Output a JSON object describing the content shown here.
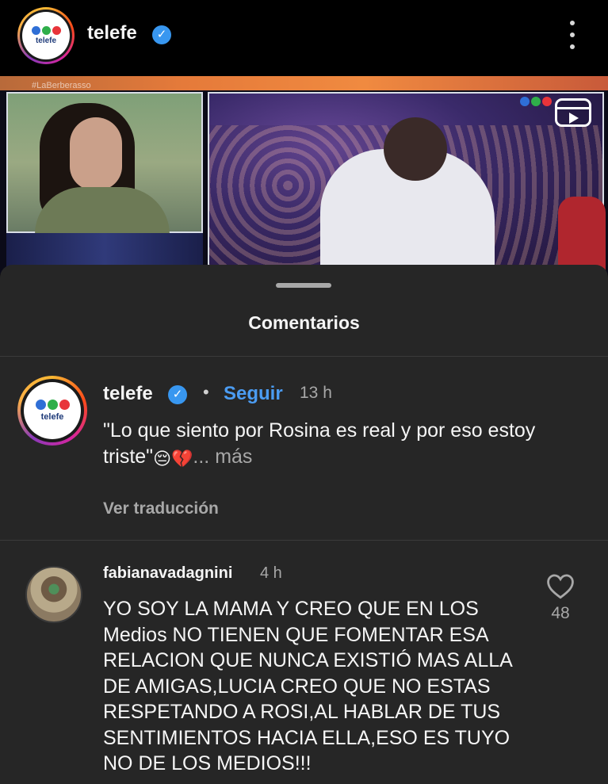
{
  "header": {
    "username": "telefe",
    "avatar_logo_text": "telefe",
    "logo_dot_colors": [
      "#2f6fd6",
      "#2fae4a",
      "#e8343a"
    ],
    "verified_color": "#3897f0",
    "more_icon": "more-vertical-icon"
  },
  "video": {
    "hashtag": "#LaBerberasso",
    "reels_icon": "reels-icon"
  },
  "sheet": {
    "title": "Comentarios"
  },
  "caption": {
    "username": "telefe",
    "avatar_logo_text": "telefe",
    "follow_label": "Seguir",
    "bullet": "•",
    "time": "13 h",
    "text": "\"Lo que siento por Rosina es real y por eso estoy triste\"",
    "emoji_1": "😔",
    "emoji_2": "💔",
    "more_label": "... más",
    "translate_label": "Ver traducción"
  },
  "comments": [
    {
      "username": "fabianavadagnini",
      "time": "4 h",
      "text": "YO SOY LA MAMA Y CREO QUE EN LOS Medios NO TIENEN QUE FOMENTAR ESA RELACION QUE NUNCA EXISTIÓ MAS ALLA DE AMIGAS,LUCIA CREO QUE NO ESTAS RESPETANDO A ROSI,AL HABLAR DE TUS SENTIMIENTOS HACIA ELLA,ESO ES TUYO NO DE LOS MEDIOS!!!",
      "likes": "48",
      "like_icon": "heart-icon"
    }
  ],
  "colors": {
    "sheet_bg": "#262626",
    "follow": "#4b9cf2",
    "secondary_text": "#a8a8a8"
  }
}
